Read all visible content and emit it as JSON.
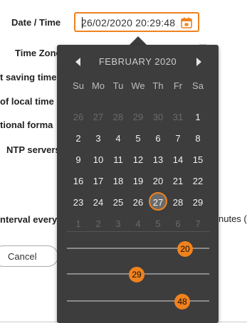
{
  "form": {
    "labels": [
      {
        "id": "date-time",
        "text": "Date / Time"
      },
      {
        "id": "time-zone",
        "text": "Time Zone"
      },
      {
        "id": "daylight-saving",
        "text": "t saving time"
      },
      {
        "id": "local-time",
        "text": "of local time"
      },
      {
        "id": "international-format",
        "text": "tional forma"
      },
      {
        "id": "ntp-servers",
        "text": "NTP servers"
      },
      {
        "id": "interval",
        "text": "nterval every"
      }
    ],
    "date_value": "26/02/2020 20:29:48",
    "minutes_text": "nutes (",
    "cancel_label": "Cancel",
    "calendar_icon": "calendar-icon"
  },
  "picker": {
    "month_label": "FEBRUARY 2020",
    "prev_icon": "triangle-left-icon",
    "next_icon": "triangle-right-icon",
    "weekdays": [
      "Su",
      "Mo",
      "Tu",
      "We",
      "Th",
      "Fr",
      "Sa"
    ],
    "weeks": [
      [
        {
          "d": "26",
          "cur": false
        },
        {
          "d": "27",
          "cur": false
        },
        {
          "d": "28",
          "cur": false
        },
        {
          "d": "29",
          "cur": false
        },
        {
          "d": "30",
          "cur": false
        },
        {
          "d": "31",
          "cur": false
        },
        {
          "d": "1",
          "cur": true
        }
      ],
      [
        {
          "d": "2",
          "cur": true
        },
        {
          "d": "3",
          "cur": true
        },
        {
          "d": "4",
          "cur": true
        },
        {
          "d": "5",
          "cur": true
        },
        {
          "d": "6",
          "cur": true
        },
        {
          "d": "7",
          "cur": true
        },
        {
          "d": "8",
          "cur": true
        }
      ],
      [
        {
          "d": "9",
          "cur": true
        },
        {
          "d": "10",
          "cur": true
        },
        {
          "d": "11",
          "cur": true
        },
        {
          "d": "12",
          "cur": true
        },
        {
          "d": "13",
          "cur": true
        },
        {
          "d": "14",
          "cur": true
        },
        {
          "d": "15",
          "cur": true
        }
      ],
      [
        {
          "d": "16",
          "cur": true
        },
        {
          "d": "17",
          "cur": true
        },
        {
          "d": "18",
          "cur": true
        },
        {
          "d": "19",
          "cur": true
        },
        {
          "d": "20",
          "cur": true
        },
        {
          "d": "21",
          "cur": true
        },
        {
          "d": "22",
          "cur": true
        }
      ],
      [
        {
          "d": "23",
          "cur": true
        },
        {
          "d": "24",
          "cur": true
        },
        {
          "d": "25",
          "cur": true
        },
        {
          "d": "26",
          "cur": true
        },
        {
          "d": "27",
          "cur": true,
          "selected": true
        },
        {
          "d": "28",
          "cur": true
        },
        {
          "d": "29",
          "cur": true
        }
      ],
      [
        {
          "d": "1",
          "cur": false
        },
        {
          "d": "2",
          "cur": false
        },
        {
          "d": "3",
          "cur": false
        },
        {
          "d": "4",
          "cur": false
        },
        {
          "d": "5",
          "cur": false
        },
        {
          "d": "6",
          "cur": false
        },
        {
          "d": "7",
          "cur": false
        }
      ]
    ],
    "sliders": [
      {
        "name": "hour-slider",
        "value": "20",
        "fraction": 0.83
      },
      {
        "name": "minute-slider",
        "value": "29",
        "fraction": 0.49
      },
      {
        "name": "second-slider",
        "value": "48",
        "fraction": 0.81
      }
    ]
  },
  "colors": {
    "accent": "#f0821e",
    "popup_bg": "#3d3d3d"
  }
}
